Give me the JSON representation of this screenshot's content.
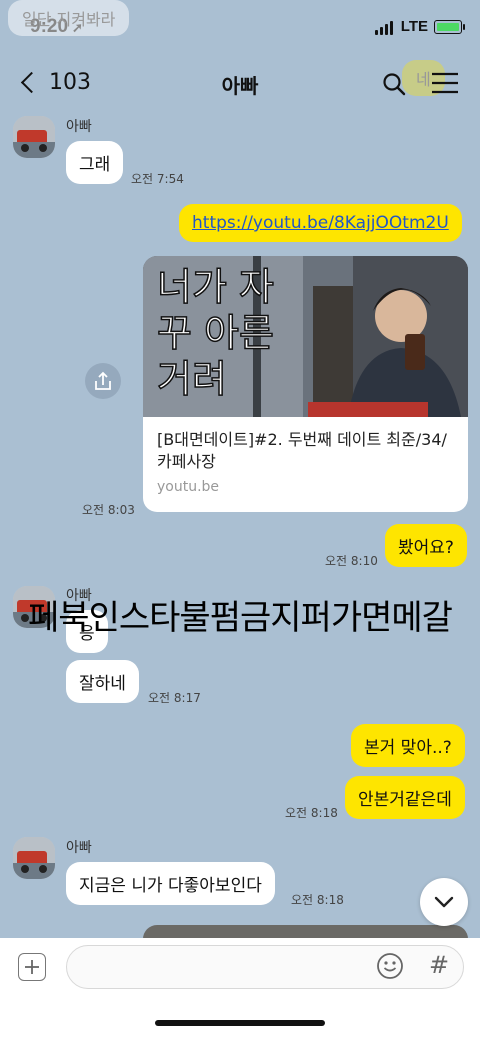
{
  "status": {
    "time": "9:20",
    "network": "LTE"
  },
  "background_bubbles": {
    "top_left": "일단  지켜봐라",
    "top_right": "네"
  },
  "header": {
    "back_count": "103",
    "title": "아빠"
  },
  "messages": [
    {
      "sender": "아빠",
      "text": "그래",
      "time": "오전 7:54"
    },
    {
      "text": "https://youtu.be/8KajjOOtm2U"
    },
    {
      "link_card": {
        "thumb_text": "너가 자꾸 아른거려",
        "title": "[B대면데이트]#2. 두번째 데이트 최준/34/카페사장",
        "domain": "youtu.be"
      },
      "time": "오전 8:03"
    },
    {
      "text": "봤어요?",
      "time": "오전 8:10"
    },
    {
      "sender": "아빠",
      "text": "응"
    },
    {
      "text": "잘하네",
      "time": "오전 8:17"
    },
    {
      "text": "본거 맞아..?"
    },
    {
      "text": "안본거같은데",
      "time": "오전 8:18"
    },
    {
      "sender": "아빠",
      "text": "지금은 니가 다좋아보인다",
      "time": "오전 8:18"
    }
  ],
  "overlay_text": "페북인스타불펌금지퍼가면메갈",
  "colors": {
    "background": "#aabfd2",
    "my_bubble": "#fee500",
    "their_bubble": "#ffffff",
    "link": "#2257c6"
  }
}
